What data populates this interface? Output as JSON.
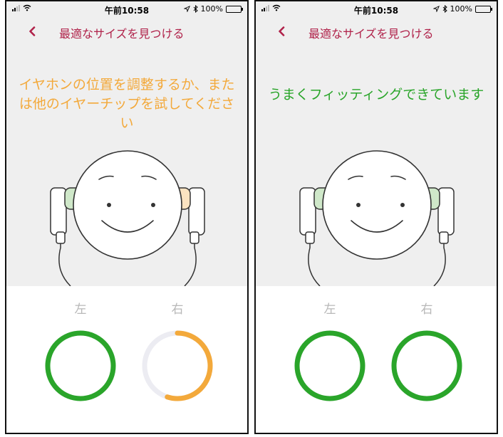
{
  "colors": {
    "accent": "#b0224a",
    "warning": "#f3a93b",
    "success": "#2aa52a",
    "ring_track": "#ececf2",
    "bud_green": "#cfe8c9",
    "bud_orange": "#fbe3c1"
  },
  "screens": [
    {
      "status": {
        "time": "午前10:58",
        "battery": "100%"
      },
      "nav": {
        "back_icon": "chevron-left-icon",
        "title": "最適なサイズを見つける"
      },
      "message": {
        "text": "イヤホンの位置を調整するか、または他のイヤーチップを試してください",
        "color": "#f3a93b"
      },
      "left": {
        "label": "左",
        "status": "good",
        "progress": 1.0,
        "color": "#2aa52a"
      },
      "right": {
        "label": "右",
        "status": "adjust",
        "progress": 0.55,
        "color": "#f3a93b"
      }
    },
    {
      "status": {
        "time": "午前10:58",
        "battery": "100%"
      },
      "nav": {
        "back_icon": "chevron-left-icon",
        "title": "最適なサイズを見つける"
      },
      "message": {
        "text": "うまくフィッティングできています",
        "color": "#2aa52a"
      },
      "left": {
        "label": "左",
        "status": "good",
        "progress": 1.0,
        "color": "#2aa52a"
      },
      "right": {
        "label": "右",
        "status": "good",
        "progress": 1.0,
        "color": "#2aa52a"
      }
    }
  ]
}
